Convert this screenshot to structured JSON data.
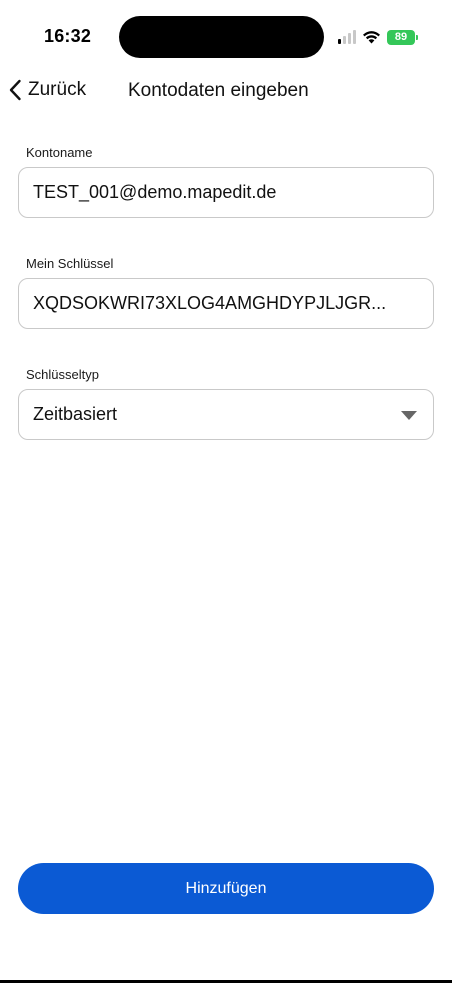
{
  "status_bar": {
    "time": "16:32",
    "battery_level": "89",
    "icons": [
      "cellular-signal-icon",
      "wifi-icon",
      "battery-charging-icon"
    ]
  },
  "nav": {
    "back_label": "Zurück",
    "title": "Kontodaten eingeben"
  },
  "form": {
    "account_name": {
      "label": "Kontoname",
      "value": "TEST_001@demo.mapedit.de"
    },
    "secret_key": {
      "label": "Mein Schlüssel",
      "value": "XQDSOKWRI73XLOG4AMGHDYPJLJGR..."
    },
    "key_type": {
      "label": "Schlüsseltyp",
      "selected": "Zeitbasiert"
    }
  },
  "submit_label": "Hinzufügen",
  "colors": {
    "primary": "#0b5ad4",
    "battery": "#34c759",
    "field_border": "#c9c9c9"
  }
}
